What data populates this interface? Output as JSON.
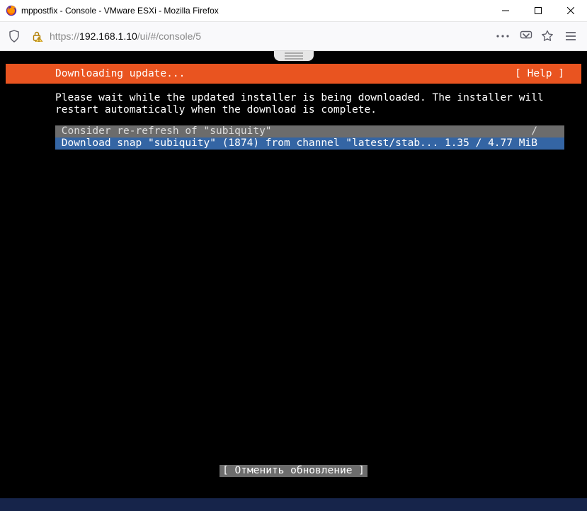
{
  "window": {
    "title": "mppostfix - Console - VMware ESXi - Mozilla Firefox"
  },
  "url": {
    "scheme": "https://",
    "host": "192.168.1.10",
    "path": "/ui/#/console/5"
  },
  "console": {
    "header_left": "Downloading update...",
    "header_right": "[ Help ]",
    "body_line1": "Please wait while the updated installer is being downloaded. The installer will",
    "body_line2": "restart automatically when the download is complete.",
    "log1": " Consider re-refresh of \"subiquity\"                                          /",
    "log2": " Download snap \"subiquity\" (1874) from channel \"latest/stab... 1.35 / 4.77 MiB",
    "cancel": "[ Отменить обновление ]"
  }
}
